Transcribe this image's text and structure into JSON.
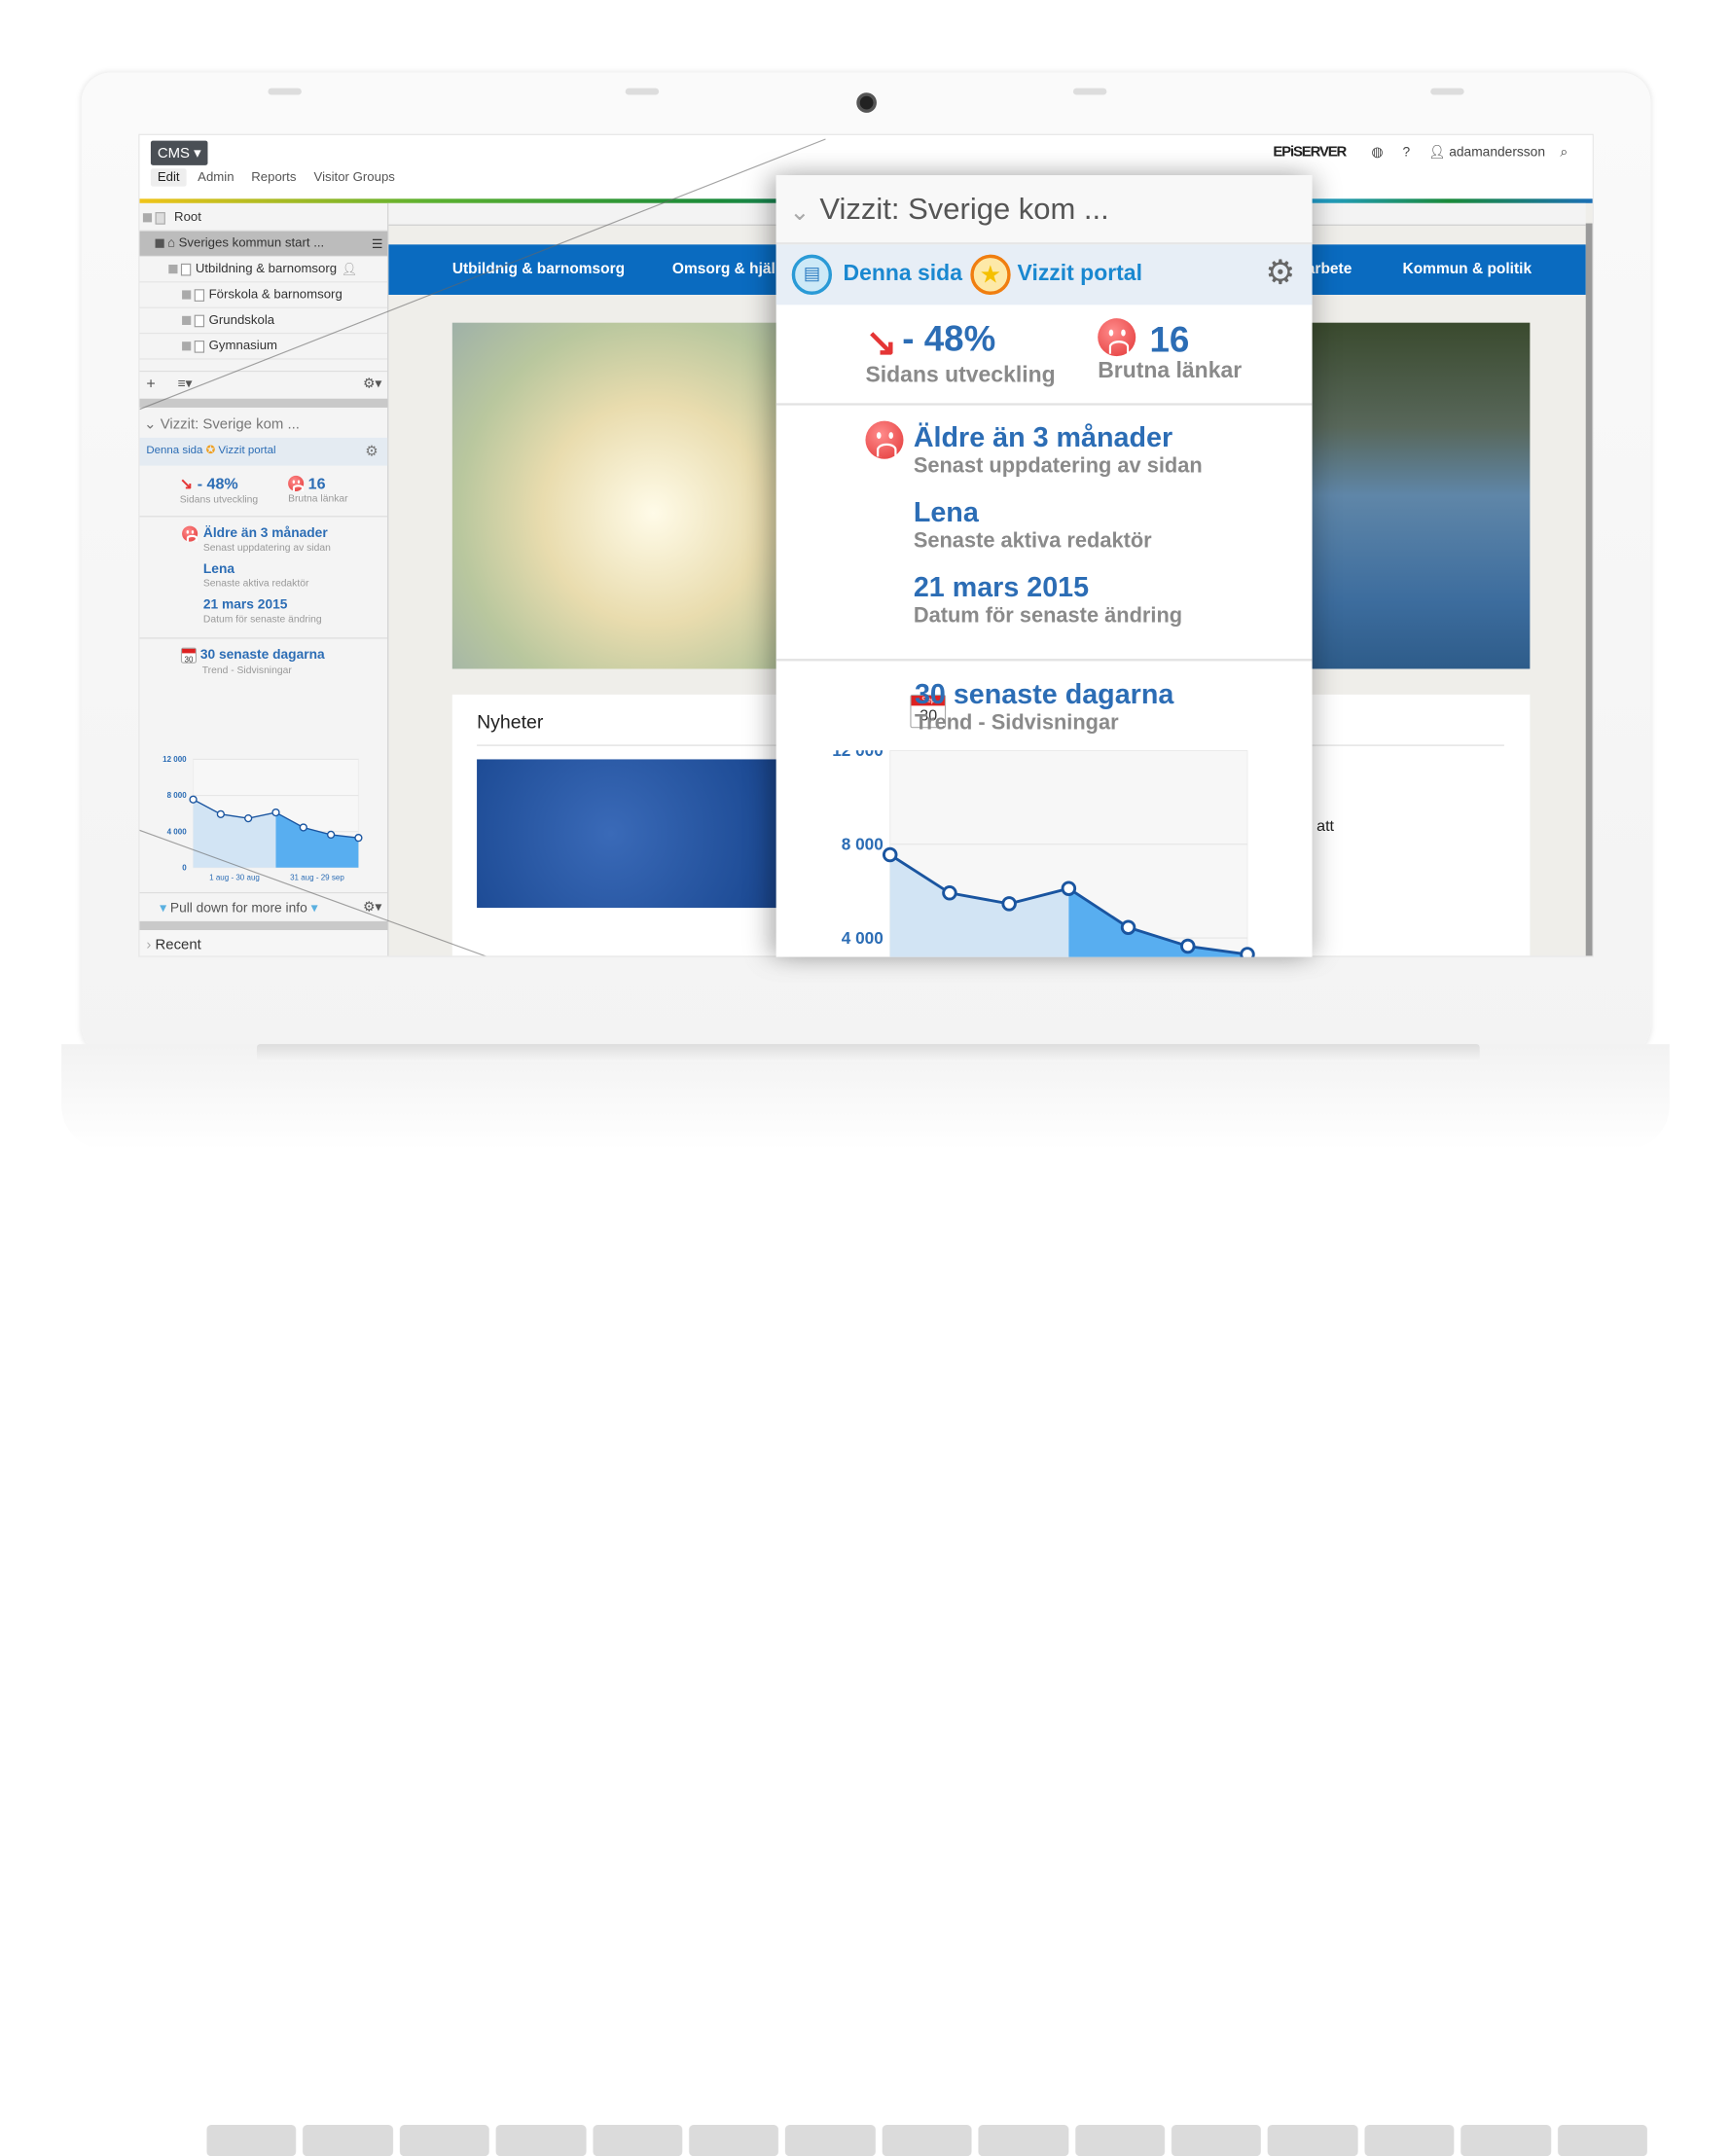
{
  "topbar": {
    "cms_label": "CMS ▾",
    "menu": [
      "Edit",
      "Admin",
      "Reports",
      "Visitor Groups"
    ],
    "brand": "EPiSERVER",
    "help": "?",
    "user": "adamandersson"
  },
  "tree": {
    "items": [
      {
        "label": "Root"
      },
      {
        "label": "Sveriges kommun start ..."
      },
      {
        "label": "Utbildning & barnomsorg"
      },
      {
        "label": "Förskola & barnomsorg"
      },
      {
        "label": "Grundskola"
      },
      {
        "label": "Gymnasium"
      }
    ],
    "add": "+",
    "list": "≡▾",
    "settings": "⚙▾"
  },
  "widget": {
    "title": "Vizzit: Sverige kom ...",
    "tab_page": "Denna sida",
    "tab_portal": "Vizzit portal",
    "change_value": "- 48%",
    "change_label": "Sidans utveckling",
    "broken_value": "16",
    "broken_label": "Brutna länkar",
    "age_value": "Äldre än 3 månader",
    "age_label": "Senast uppdatering av sidan",
    "editor_value": "Lena",
    "editor_label": "Senaste aktiva redaktör",
    "date_value": "21 mars 2015",
    "date_label": "Datum för senaste ändring",
    "trend_title": "30 senaste dagarna",
    "trend_sub": "Trend - Sidvisningar",
    "cal_month": "Sep",
    "cal_day": "30",
    "pull_down": "Pull down for more info",
    "recent": "Recent"
  },
  "site": {
    "nav": [
      "Utbildnig & barnomsorg",
      "Omsorg & hjälp",
      "arbete",
      "Kommun & politik"
    ],
    "news_title": "Nyheter",
    "snippet": "att"
  },
  "colors": {
    "accent": "#2c6db5",
    "nav": "#0a6bc0",
    "period1": "#d2e4f4",
    "period2": "#58aef0",
    "line": "#1a55a0"
  },
  "chart_data": {
    "type": "area",
    "ylim": [
      0,
      12000
    ],
    "yticks": [
      "0",
      "4 000",
      "8 000",
      "12 000"
    ],
    "xtick_labels": [
      "1 aug - 30 aug",
      "31 aug - 29 sep"
    ],
    "values": [
      7550,
      5920,
      5460,
      6110,
      4450,
      3650,
      3300
    ],
    "split_index": 3
  }
}
